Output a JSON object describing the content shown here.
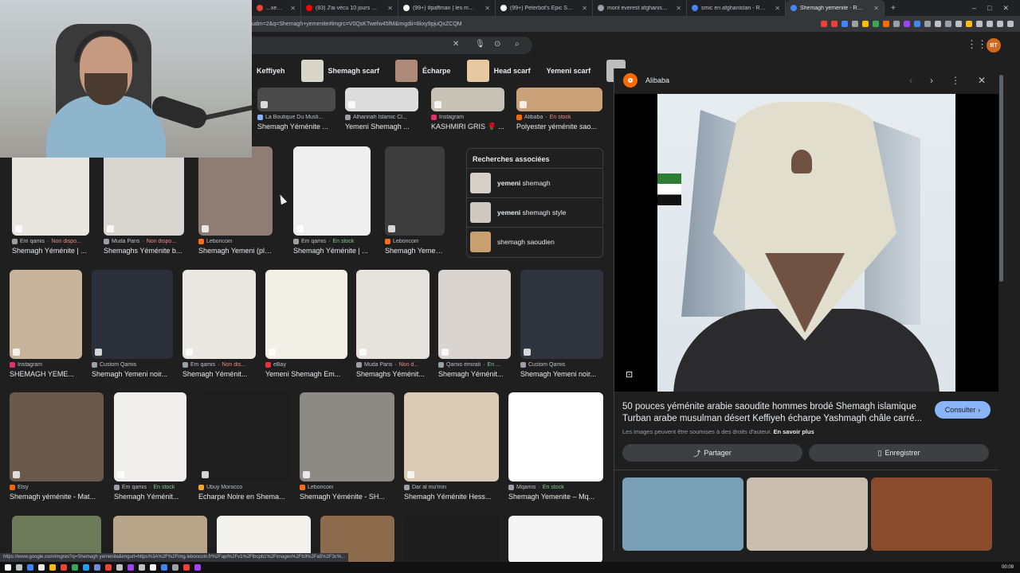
{
  "browser": {
    "tabs": [
      {
        "label": "...xe FLASH | Un",
        "color": "#ea4335"
      },
      {
        "label": "(83) J'ai vécu 10 jours avec les Taliba",
        "color": "#ff0000"
      },
      {
        "label": "(99+) #paffman | les marocaines | Tik",
        "color": "#ffffff"
      },
      {
        "label": "(99+) Peterbot's Epic Solo Cash Cup",
        "color": "#ffffff"
      },
      {
        "label": "mont everest afghanistan distance",
        "color": "#9aa0a6"
      },
      {
        "label": "smic en afghanistan - Recherche Go",
        "color": "#4285f4"
      },
      {
        "label": "Shemagh yemenite - Recherch",
        "color": "#4285f4",
        "active": true
      }
    ],
    "new_tab": "+",
    "url": "udm=2&q=Shemagh+yemenite#imgrc=V0QsKTwefw45fM&imgdii=6kxy9pjuQxZCQM",
    "status_url": "https://www.google.com/imgres?q=Shemagh yemenite&imgurl=https%3A%2F%2Fimg.leboncoin.fr%2Fapi%2Fv1%2Flbcpb1%2Fimages%2Fb3%2Fa5%2F3c%..."
  },
  "header": {
    "avatar_initials": "BT"
  },
  "chips": [
    {
      "label": "Keffiyeh",
      "color": ""
    },
    {
      "label": "Shemagh scarf",
      "color": "#d9d5c9"
    },
    {
      "label": "Écharpe",
      "color": "#b08a78"
    },
    {
      "label": "Head scarf",
      "color": "#e6c9a0"
    },
    {
      "label": "Yemeni scarf",
      "color": ""
    }
  ],
  "results": {
    "row0": [
      {
        "source": "La Boutique Du Musli...",
        "title": "Shemagh Yéménite ...",
        "stock": "",
        "img": "#4a4a4a",
        "fav": "#8ab4f8"
      },
      {
        "source": "Alhannah Islamic Cl...",
        "title": "Yemeni Shemagh ...",
        "stock": "",
        "img": "#dcdcdc",
        "fav": "#9aa0a6"
      },
      {
        "source": "Instagram",
        "title": "KASHMIRI GRIS 🌹 ...",
        "stock": "",
        "img": "#c8c1b6",
        "fav": "#e1306c"
      },
      {
        "source": "Alibaba",
        "title": "Polyester yéménite sao...",
        "stock": "En stock",
        "img": "#caa27a",
        "fav": "#ff6a00"
      }
    ],
    "row1": [
      {
        "source": "Em qamis",
        "title": "Shemagh Yéménite | ...",
        "stock": "Non dispo...",
        "stock_type": "no",
        "img": "#e8e6df",
        "fav": "#9aa0a6"
      },
      {
        "source": "Muda Paris",
        "title": "Shemaghs Yéménite b...",
        "stock": "Non dispo...",
        "stock_type": "no",
        "img": "#d8d6d0",
        "fav": "#9aa0a6"
      },
      {
        "source": "Leboncoin",
        "title": "Shemagh Yemeni (plu...",
        "stock": "",
        "img": "#8e7d74",
        "fav": "#ff6e14"
      },
      {
        "source": "Em qamis",
        "title": "Shemagh Yéménite | ...",
        "stock": "En stock",
        "stock_type": "yes",
        "img": "#eeeeee",
        "fav": "#9aa0a6"
      },
      {
        "source": "Leboncoin",
        "title": "Shemagh Yemeni (...",
        "stock": "",
        "img": "#3c3c3c",
        "fav": "#ff6e14"
      }
    ],
    "related": {
      "title": "Recherches associées",
      "items": [
        {
          "bold": "yemeni",
          "rest": " shemagh",
          "color": "#d7d0c8"
        },
        {
          "bold": "yemeni",
          "rest": " shemagh style",
          "color": "#cfc8c0"
        },
        {
          "bold": "",
          "rest": "shemagh saoudien",
          "color": "#c9a070"
        }
      ]
    },
    "row2": [
      {
        "source": "Instagram",
        "title": "SHEMAGH YEME...",
        "stock": "",
        "img": "#c7b49a",
        "fav": "#e1306c"
      },
      {
        "source": "Custom Qamis",
        "title": "Shemagh Yemeni noir...",
        "stock": "",
        "img": "#2a2f3a",
        "fav": "#9aa0a6"
      },
      {
        "source": "Em qamis",
        "title": "Shemagh Yéménit...",
        "stock": "Non dis...",
        "stock_type": "no",
        "img": "#ebe8e2",
        "fav": "#9aa0a6"
      },
      {
        "source": "eBay",
        "title": "Yemeni Shemagh Em...",
        "stock": "",
        "img": "#f2efe6",
        "fav": "#e53238"
      },
      {
        "source": "Muda Paris",
        "title": "Shemaghs Yéménit...",
        "stock": "Non d...",
        "stock_type": "no",
        "img": "#e6e3dc",
        "fav": "#9aa0a6"
      },
      {
        "source": "Qamis émirati",
        "title": "Shemagh Yéménit...",
        "stock": "En ...",
        "stock_type": "yes",
        "img": "#d9d4cf",
        "fav": "#9aa0a6"
      },
      {
        "source": "Custom Qamis",
        "title": "Shemagh Yemeni noir...",
        "stock": "",
        "img": "#30343f",
        "fav": "#9aa0a6"
      }
    ],
    "row3": [
      {
        "source": "Etsy",
        "title": "Shemagh yéménite - Mat...",
        "stock": "",
        "img": "#6b5a4c",
        "fav": "#f56400"
      },
      {
        "source": "Em qamis",
        "title": "Shemagh Yéménit...",
        "stock": "En stock",
        "stock_type": "yes",
        "img": "#f0efec",
        "fav": "#9aa0a6"
      },
      {
        "source": "Ubuy Morocco",
        "title": "Echarpe Noire en Shema...",
        "stock": "",
        "img": "#1e1e1e",
        "fav": "#f5a623"
      },
      {
        "source": "Leboncoin",
        "title": "Shemagh Yéménite - SH...",
        "stock": "",
        "img": "#8d8a85",
        "fav": "#ff6e14"
      },
      {
        "source": "Dar al mu'min",
        "title": "Shemagh Yéménite Hess...",
        "stock": "",
        "img": "#d9c9b5",
        "fav": "#9aa0a6"
      },
      {
        "source": "Mqamis",
        "title": "Shemagh Yemenite – Mq...",
        "stock": "En stock",
        "stock_type": "yes",
        "img": "#ffffff",
        "fav": "#9aa0a6"
      }
    ],
    "row4_colors": [
      "#6c7a5a",
      "#b7a58a",
      "#f3f1ec",
      "#8c6a4c",
      "#1d1d1d",
      "#f5f5f5"
    ]
  },
  "panel": {
    "site": "Alibaba",
    "title": "50 pouces yéménite arabie saoudite hommes brodé Shemagh islamique Turban arabe musulman désert Keffiyeh écharpe Yashmagh châle carré...",
    "consult_label": "Consulter",
    "rights_text": "Les images peuvent être soumises à des droits d'auteur.",
    "rights_link": "En savoir plus",
    "share_label": "Partager",
    "save_label": "Enregistrer",
    "more_colors": [
      "#7aa0b8",
      "#c9beb0",
      "#8a4a2c"
    ]
  },
  "taskbar": {
    "clock": "00:09"
  }
}
